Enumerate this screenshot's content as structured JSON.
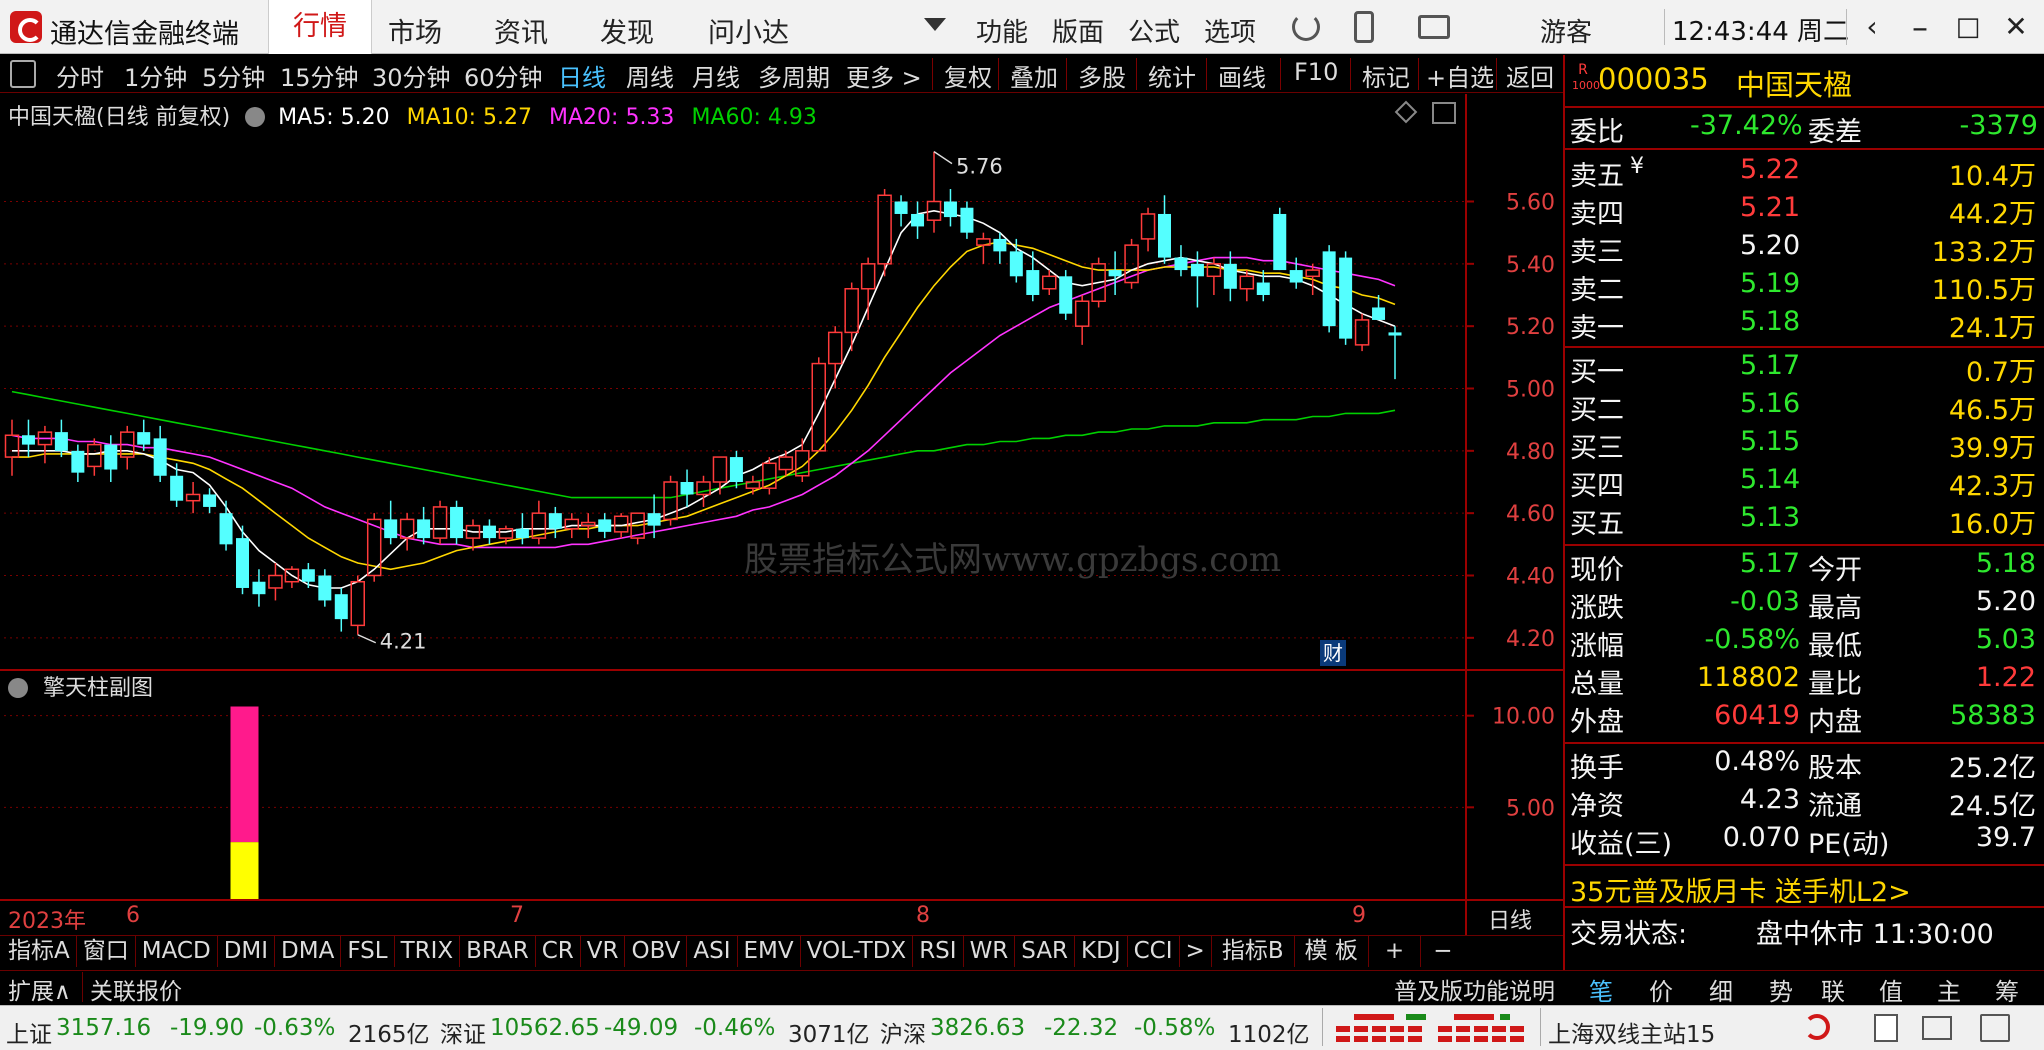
{
  "app": {
    "title": "通达信金融终端",
    "menu": [
      "行情",
      "市场",
      "资讯",
      "发现",
      "问小达"
    ],
    "tools": [
      "功能",
      "版面",
      "公式",
      "选项"
    ],
    "user": "游客",
    "clock": "12:43:44 周二"
  },
  "periods": [
    "分时",
    "1分钟",
    "5分钟",
    "15分钟",
    "30分钟",
    "60分钟",
    "日线",
    "周线",
    "月线",
    "多周期",
    "更多 >"
  ],
  "active_period": "日线",
  "toolbar_actions": [
    "复权",
    "叠加",
    "多股",
    "统计",
    "画线",
    "F10",
    "标记",
    "+自选",
    "返回"
  ],
  "main_chart": {
    "title": "中国天楹(日线 前复权)",
    "ma": [
      {
        "label": "MA5: 5.20",
        "color": "#ffffff"
      },
      {
        "label": "MA10: 5.27",
        "color": "#ffd700"
      },
      {
        "label": "MA20: 5.33",
        "color": "#ff33ff"
      },
      {
        "label": "MA60: 4.93",
        "color": "#00d000"
      }
    ],
    "high_label": "5.76",
    "low_label": "4.21",
    "cai_badge": "财",
    "watermark": "股票指标公式网www.gpzbgs.com"
  },
  "sub_chart": {
    "title": "擎天柱副图",
    "y_ticks": [
      "10.00",
      "5.00"
    ]
  },
  "date_axis": {
    "labels": [
      "2023年",
      "6",
      "7",
      "8",
      "9"
    ],
    "period_label": "日线"
  },
  "chart_data": {
    "type": "candlestick",
    "ylim": [
      4.1,
      5.9
    ],
    "y_ticks": [
      "5.60",
      "5.40",
      "5.20",
      "5.00",
      "4.80",
      "4.60",
      "4.40",
      "4.20"
    ],
    "candles": [
      [
        4.78,
        4.9,
        4.72,
        4.85
      ],
      [
        4.85,
        4.9,
        4.78,
        4.82
      ],
      [
        4.82,
        4.88,
        4.76,
        4.86
      ],
      [
        4.86,
        4.9,
        4.78,
        4.8
      ],
      [
        4.8,
        4.82,
        4.7,
        4.73
      ],
      [
        4.75,
        4.84,
        4.72,
        4.82
      ],
      [
        4.82,
        4.85,
        4.7,
        4.74
      ],
      [
        4.78,
        4.88,
        4.74,
        4.86
      ],
      [
        4.86,
        4.9,
        4.8,
        4.82
      ],
      [
        4.84,
        4.88,
        4.7,
        4.72
      ],
      [
        4.72,
        4.76,
        4.62,
        4.64
      ],
      [
        4.64,
        4.7,
        4.6,
        4.66
      ],
      [
        4.66,
        4.68,
        4.6,
        4.62
      ],
      [
        4.6,
        4.64,
        4.48,
        4.5
      ],
      [
        4.52,
        4.56,
        4.34,
        4.36
      ],
      [
        4.38,
        4.42,
        4.3,
        4.34
      ],
      [
        4.36,
        4.44,
        4.32,
        4.4
      ],
      [
        4.38,
        4.43,
        4.36,
        4.42
      ],
      [
        4.42,
        4.44,
        4.36,
        4.38
      ],
      [
        4.4,
        4.42,
        4.3,
        4.32
      ],
      [
        4.34,
        4.36,
        4.22,
        4.26
      ],
      [
        4.24,
        4.4,
        4.21,
        4.38
      ],
      [
        4.4,
        4.6,
        4.38,
        4.58
      ],
      [
        4.58,
        4.64,
        4.5,
        4.52
      ],
      [
        4.52,
        4.6,
        4.48,
        4.58
      ],
      [
        4.58,
        4.62,
        4.5,
        4.52
      ],
      [
        4.52,
        4.64,
        4.5,
        4.62
      ],
      [
        4.62,
        4.64,
        4.5,
        4.52
      ],
      [
        4.52,
        4.58,
        4.48,
        4.56
      ],
      [
        4.56,
        4.58,
        4.5,
        4.52
      ],
      [
        4.52,
        4.56,
        4.5,
        4.55
      ],
      [
        4.55,
        4.6,
        4.5,
        4.52
      ],
      [
        4.52,
        4.64,
        4.5,
        4.6
      ],
      [
        4.6,
        4.62,
        4.52,
        4.55
      ],
      [
        4.55,
        4.6,
        4.52,
        4.58
      ],
      [
        4.56,
        4.6,
        4.52,
        4.57
      ],
      [
        4.58,
        4.6,
        4.52,
        4.54
      ],
      [
        4.54,
        4.6,
        4.52,
        4.59
      ],
      [
        4.52,
        4.6,
        4.5,
        4.6
      ],
      [
        4.6,
        4.66,
        4.52,
        4.56
      ],
      [
        4.58,
        4.72,
        4.56,
        4.7
      ],
      [
        4.7,
        4.74,
        4.62,
        4.66
      ],
      [
        4.66,
        4.72,
        4.62,
        4.7
      ],
      [
        4.7,
        4.78,
        4.66,
        4.78
      ],
      [
        4.78,
        4.8,
        4.68,
        4.7
      ],
      [
        4.68,
        4.72,
        4.66,
        4.7
      ],
      [
        4.68,
        4.78,
        4.66,
        4.76
      ],
      [
        4.74,
        4.8,
        4.72,
        4.78
      ],
      [
        4.72,
        4.84,
        4.7,
        4.8
      ],
      [
        4.8,
        5.1,
        4.8,
        5.08
      ],
      [
        5.08,
        5.2,
        5.0,
        5.18
      ],
      [
        5.18,
        5.34,
        5.12,
        5.32
      ],
      [
        5.32,
        5.42,
        5.22,
        5.4
      ],
      [
        5.4,
        5.64,
        5.36,
        5.62
      ],
      [
        5.6,
        5.62,
        5.52,
        5.56
      ],
      [
        5.56,
        5.6,
        5.48,
        5.52
      ],
      [
        5.54,
        5.76,
        5.5,
        5.6
      ],
      [
        5.6,
        5.64,
        5.52,
        5.55
      ],
      [
        5.58,
        5.6,
        5.48,
        5.5
      ],
      [
        5.46,
        5.5,
        5.4,
        5.48
      ],
      [
        5.48,
        5.5,
        5.4,
        5.44
      ],
      [
        5.44,
        5.48,
        5.34,
        5.36
      ],
      [
        5.38,
        5.44,
        5.28,
        5.3
      ],
      [
        5.32,
        5.38,
        5.3,
        5.36
      ],
      [
        5.36,
        5.38,
        5.22,
        5.24
      ],
      [
        5.2,
        5.3,
        5.14,
        5.28
      ],
      [
        5.28,
        5.42,
        5.26,
        5.4
      ],
      [
        5.38,
        5.44,
        5.3,
        5.36
      ],
      [
        5.34,
        5.48,
        5.32,
        5.46
      ],
      [
        5.48,
        5.58,
        5.44,
        5.56
      ],
      [
        5.56,
        5.62,
        5.4,
        5.42
      ],
      [
        5.42,
        5.46,
        5.36,
        5.38
      ],
      [
        5.4,
        5.44,
        5.26,
        5.36
      ],
      [
        5.36,
        5.42,
        5.3,
        5.4
      ],
      [
        5.4,
        5.44,
        5.28,
        5.32
      ],
      [
        5.32,
        5.38,
        5.28,
        5.36
      ],
      [
        5.34,
        5.38,
        5.28,
        5.3
      ],
      [
        5.56,
        5.58,
        5.38,
        5.38
      ],
      [
        5.38,
        5.42,
        5.32,
        5.34
      ],
      [
        5.36,
        5.4,
        5.3,
        5.38
      ],
      [
        5.44,
        5.46,
        5.18,
        5.2
      ],
      [
        5.42,
        5.44,
        5.14,
        5.16
      ],
      [
        5.14,
        5.24,
        5.12,
        5.22
      ],
      [
        5.26,
        5.3,
        5.22,
        5.22
      ],
      [
        5.18,
        5.2,
        5.03,
        5.17
      ]
    ],
    "ma5": [
      4.8,
      4.8,
      4.8,
      4.8,
      4.79,
      4.79,
      4.8,
      4.8,
      4.79,
      4.77,
      4.74,
      4.73,
      4.69,
      4.62,
      4.54,
      4.48,
      4.44,
      4.4,
      4.37,
      4.36,
      4.36,
      4.38,
      4.42,
      4.47,
      4.52,
      4.55,
      4.55,
      4.55,
      4.54,
      4.54,
      4.54,
      4.55,
      4.55,
      4.55,
      4.56,
      4.56,
      4.56,
      4.56,
      4.57,
      4.58,
      4.6,
      4.62,
      4.65,
      4.68,
      4.72,
      4.74,
      4.77,
      4.79,
      4.82,
      4.92,
      5.03,
      5.14,
      5.26,
      5.38,
      5.5,
      5.56,
      5.57,
      5.56,
      5.55,
      5.53,
      5.5,
      5.45,
      5.42,
      5.38,
      5.34,
      5.33,
      5.34,
      5.35,
      5.38,
      5.4,
      5.41,
      5.42,
      5.41,
      5.4,
      5.38,
      5.37,
      5.36,
      5.36,
      5.35,
      5.33,
      5.3,
      5.27,
      5.24,
      5.22,
      5.2
    ],
    "ma10": [
      4.78,
      4.78,
      4.79,
      4.79,
      4.79,
      4.79,
      4.79,
      4.79,
      4.79,
      4.78,
      4.77,
      4.76,
      4.74,
      4.71,
      4.68,
      4.64,
      4.6,
      4.56,
      4.52,
      4.49,
      4.46,
      4.44,
      4.43,
      4.42,
      4.43,
      4.44,
      4.46,
      4.48,
      4.49,
      4.5,
      4.51,
      4.52,
      4.53,
      4.54,
      4.55,
      4.55,
      4.56,
      4.56,
      4.56,
      4.57,
      4.58,
      4.59,
      4.61,
      4.63,
      4.65,
      4.67,
      4.69,
      4.72,
      4.75,
      4.8,
      4.86,
      4.93,
      5.01,
      5.1,
      5.18,
      5.26,
      5.33,
      5.39,
      5.44,
      5.46,
      5.47,
      5.46,
      5.45,
      5.43,
      5.41,
      5.39,
      5.38,
      5.38,
      5.38,
      5.38,
      5.39,
      5.39,
      5.39,
      5.39,
      5.38,
      5.38,
      5.37,
      5.37,
      5.36,
      5.35,
      5.33,
      5.32,
      5.3,
      5.29,
      5.27
    ],
    "ma20": [
      4.85,
      4.84,
      4.84,
      4.84,
      4.83,
      4.83,
      4.82,
      4.82,
      4.81,
      4.81,
      4.8,
      4.79,
      4.78,
      4.76,
      4.74,
      4.72,
      4.7,
      4.68,
      4.65,
      4.62,
      4.6,
      4.58,
      4.56,
      4.54,
      4.52,
      4.51,
      4.5,
      4.5,
      4.49,
      4.49,
      4.49,
      4.49,
      4.49,
      4.49,
      4.5,
      4.5,
      4.51,
      4.52,
      4.53,
      4.54,
      4.55,
      4.56,
      4.57,
      4.58,
      4.59,
      4.61,
      4.62,
      4.64,
      4.66,
      4.69,
      4.72,
      4.76,
      4.8,
      4.85,
      4.9,
      4.95,
      5.0,
      5.05,
      5.09,
      5.13,
      5.17,
      5.2,
      5.23,
      5.26,
      5.28,
      5.3,
      5.32,
      5.34,
      5.36,
      5.38,
      5.39,
      5.4,
      5.41,
      5.42,
      5.42,
      5.42,
      5.41,
      5.41,
      5.4,
      5.39,
      5.38,
      5.37,
      5.36,
      5.35,
      5.33
    ],
    "ma60": [
      4.99,
      4.98,
      4.97,
      4.96,
      4.95,
      4.94,
      4.93,
      4.92,
      4.91,
      4.9,
      4.89,
      4.88,
      4.87,
      4.86,
      4.85,
      4.84,
      4.83,
      4.82,
      4.81,
      4.8,
      4.79,
      4.78,
      4.77,
      4.76,
      4.75,
      4.74,
      4.73,
      4.72,
      4.71,
      4.7,
      4.69,
      4.68,
      4.67,
      4.66,
      4.65,
      4.65,
      4.65,
      4.65,
      4.65,
      4.65,
      4.65,
      4.66,
      4.67,
      4.68,
      4.69,
      4.7,
      4.71,
      4.72,
      4.73,
      4.74,
      4.75,
      4.76,
      4.77,
      4.78,
      4.79,
      4.8,
      4.8,
      4.81,
      4.82,
      4.82,
      4.83,
      4.83,
      4.84,
      4.84,
      4.85,
      4.85,
      4.86,
      4.86,
      4.87,
      4.87,
      4.88,
      4.88,
      4.88,
      4.89,
      4.89,
      4.89,
      4.9,
      4.9,
      4.9,
      4.91,
      4.91,
      4.92,
      4.92,
      4.92,
      4.93
    ],
    "sub_bar": {
      "index": 14,
      "pink_value": 10.5,
      "yellow_value": 3.1,
      "ylim": [
        0,
        12
      ]
    }
  },
  "indicator_tabs": [
    "指标A",
    "窗口",
    "MACD",
    "DMI",
    "DMA",
    "FSL",
    "TRIX",
    "BRAR",
    "CR",
    "VR",
    "OBV",
    "ASI",
    "EMV",
    "VOL-TDX",
    "RSI",
    "WR",
    "SAR",
    "KDJ",
    "CCI",
    ">",
    "指标B",
    "模 板",
    "+",
    "−"
  ],
  "ext_bar": {
    "left": [
      "扩展∧",
      "关联报价"
    ],
    "right_label": "普及版功能说明",
    "panel_tabs": [
      "笔",
      "价",
      "细",
      "势",
      "联",
      "值",
      "主",
      "筹"
    ]
  },
  "stock": {
    "badge_top": "R",
    "badge_bottom": "1000",
    "code": "000035",
    "name": "中国天楹"
  },
  "order_book": {
    "weibi_label": "委比",
    "weibi": "-37.42%",
    "weicha_label": "委差",
    "weicha": "-3379",
    "asks": [
      {
        "label": "卖五",
        "flag": "¥",
        "price": "5.22",
        "vol": "10.4万",
        "color": "red"
      },
      {
        "label": "卖四",
        "flag": "",
        "price": "5.21",
        "vol": "44.2万",
        "color": "red"
      },
      {
        "label": "卖三",
        "flag": "",
        "price": "5.20",
        "vol": "133.2万",
        "color": "white"
      },
      {
        "label": "卖二",
        "flag": "",
        "price": "5.19",
        "vol": "110.5万",
        "color": "green"
      },
      {
        "label": "卖一",
        "flag": "",
        "price": "5.18",
        "vol": "24.1万",
        "color": "green"
      }
    ],
    "bids": [
      {
        "label": "买一",
        "price": "5.17",
        "vol": "0.7万",
        "color": "green"
      },
      {
        "label": "买二",
        "price": "5.16",
        "vol": "46.5万",
        "color": "green"
      },
      {
        "label": "买三",
        "price": "5.15",
        "vol": "39.9万",
        "color": "green"
      },
      {
        "label": "买四",
        "price": "5.14",
        "vol": "42.3万",
        "color": "green"
      },
      {
        "label": "买五",
        "price": "5.13",
        "vol": "16.0万",
        "color": "green"
      }
    ]
  },
  "quote": [
    {
      "l1": "现价",
      "v1": "5.17",
      "c1": "green",
      "l2": "今开",
      "v2": "5.18",
      "c2": "green"
    },
    {
      "l1": "涨跌",
      "v1": "-0.03",
      "c1": "green",
      "l2": "最高",
      "v2": "5.20",
      "c2": "white"
    },
    {
      "l1": "涨幅",
      "v1": "-0.58%",
      "c1": "green",
      "l2": "最低",
      "v2": "5.03",
      "c2": "green"
    },
    {
      "l1": "总量",
      "v1": "118802",
      "c1": "yellow",
      "l2": "量比",
      "v2": "1.22",
      "c2": "red"
    },
    {
      "l1": "外盘",
      "v1": "60419",
      "c1": "red",
      "l2": "内盘",
      "v2": "58383",
      "c2": "green"
    }
  ],
  "fundamentals": [
    {
      "l1": "换手",
      "v1": "0.48%",
      "l2": "股本",
      "v2": "25.2亿"
    },
    {
      "l1": "净资",
      "v1": "4.23",
      "l2": "流通",
      "v2": "24.5亿"
    },
    {
      "l1": "收益(三)",
      "v1": "0.070",
      "l2": "PE(动)",
      "v2": "39.7"
    }
  ],
  "promo": "35元普及版月卡 送手机L2>",
  "trade_status": {
    "label": "交易状态:",
    "value": "盘中休市 11:30:00"
  },
  "status_bar": {
    "sh": {
      "name": "上证",
      "value": "3157.16",
      "chg": "-19.90",
      "pct": "-0.63%",
      "amt": "2165亿"
    },
    "sz": {
      "name": "深证",
      "value": "10562.65",
      "chg": "-49.09",
      "pct": "-0.46%",
      "amt": "3071亿"
    },
    "hs": {
      "name": "沪深",
      "value": "3826.63",
      "chg": "-22.32",
      "pct": "-0.58%",
      "amt": "1102亿"
    },
    "server": "上海双线主站15"
  }
}
